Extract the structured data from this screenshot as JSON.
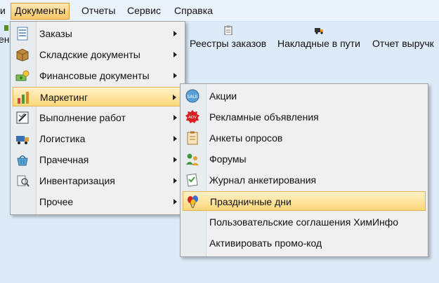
{
  "menubar": {
    "items": [
      "и",
      "Документы",
      "Отчеты",
      "Сервис",
      "Справка"
    ]
  },
  "toolbar": {
    "left_fragment": "ен",
    "buttons": [
      {
        "label": "Реестры заказов",
        "icon": "clipboard-icon"
      },
      {
        "label": "Накладные в пути",
        "icon": "truck-icon"
      },
      {
        "label": "Отчет выручк",
        "icon": "report-icon"
      }
    ]
  },
  "documents_menu": {
    "items": [
      {
        "label": "Заказы",
        "icon": "orders-icon",
        "submenu": true
      },
      {
        "label": "Складские документы",
        "icon": "box-icon",
        "submenu": true
      },
      {
        "label": "Финансовые документы",
        "icon": "money-icon",
        "submenu": true
      },
      {
        "label": "Маркетинг",
        "icon": "marketing-chart-icon",
        "submenu": true,
        "highlighted": true
      },
      {
        "label": "Выполнение работ",
        "icon": "work-icon",
        "submenu": true
      },
      {
        "label": "Логистика",
        "icon": "truck-icon",
        "submenu": true
      },
      {
        "label": "Прачечная",
        "icon": "basket-icon",
        "submenu": true
      },
      {
        "label": "Инвентаризация",
        "icon": "inventory-icon",
        "submenu": true
      },
      {
        "label": "Прочее",
        "icon": "",
        "submenu": true
      }
    ]
  },
  "marketing_submenu": {
    "items": [
      {
        "label": "Акции",
        "icon": "sale-icon"
      },
      {
        "label": "Рекламные объявления",
        "icon": "adv-icon"
      },
      {
        "label": "Анкеты опросов",
        "icon": "survey-icon"
      },
      {
        "label": "Форумы",
        "icon": "forum-icon"
      },
      {
        "label": "Журнал анкетирования",
        "icon": "journal-icon"
      },
      {
        "label": "Праздничные дни",
        "icon": "balloons-icon",
        "highlighted": true
      },
      {
        "label": "Пользовательские соглашения ХимИнфо",
        "icon": ""
      },
      {
        "label": "Активировать промо-код",
        "icon": ""
      }
    ]
  },
  "colors": {
    "background": "#dcebf7",
    "highlight_top": "#fff2c8",
    "highlight_bottom": "#fbd779",
    "active_menu": "#f9c868"
  }
}
